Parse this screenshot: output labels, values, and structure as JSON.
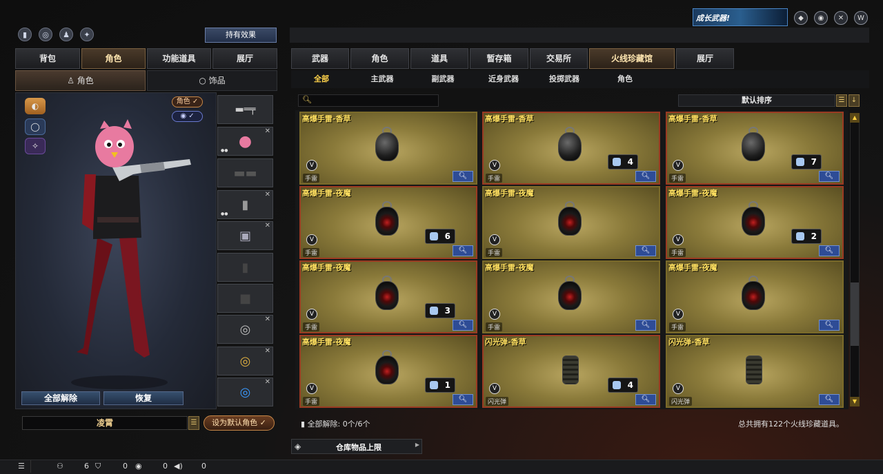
{
  "top": {
    "hold_effect": "持有效果",
    "promo": "成长武器!"
  },
  "left_tabs": [
    "背包",
    "角色",
    "功能道具",
    "展厅"
  ],
  "left_subtabs": [
    "角色",
    "饰品"
  ],
  "right_tabs": [
    "武器",
    "角色",
    "道具",
    "暂存箱",
    "交易所",
    "火线珍藏馆",
    "展厅"
  ],
  "categories": [
    "全部",
    "主武器",
    "副武器",
    "近身武器",
    "投掷武器",
    "角色"
  ],
  "character": {
    "toggle_role": "角色 ✓",
    "toggle_eye": "✓",
    "unequip_all": "全部解除",
    "restore": "恢复",
    "name": "凌霄",
    "set_default": "设为默认角色 ✓"
  },
  "sort_label": "默认排序",
  "items": [
    {
      "title": "高爆手雷-香草",
      "count": "",
      "tag": "手雷",
      "kind": "vanilla",
      "red": false
    },
    {
      "title": "高爆手雷-香草",
      "count": "4",
      "tag": "手雷",
      "kind": "vanilla",
      "red": true
    },
    {
      "title": "高爆手雷-香草",
      "count": "7",
      "tag": "手雷",
      "kind": "vanilla",
      "red": true
    },
    {
      "title": "高爆手雷-夜魔",
      "count": "6",
      "tag": "手雷",
      "kind": "night",
      "red": true
    },
    {
      "title": "高爆手雷-夜魔",
      "count": "",
      "tag": "手雷",
      "kind": "night",
      "red": false
    },
    {
      "title": "高爆手雷-夜魔",
      "count": "2",
      "tag": "手雷",
      "kind": "night",
      "red": true
    },
    {
      "title": "高爆手雷-夜魔",
      "count": "3",
      "tag": "手雷",
      "kind": "night",
      "red": true
    },
    {
      "title": "高爆手雷-夜魔",
      "count": "",
      "tag": "手雷",
      "kind": "night",
      "red": false
    },
    {
      "title": "高爆手雷-夜魔",
      "count": "",
      "tag": "手雷",
      "kind": "night",
      "red": false
    },
    {
      "title": "高爆手雷-夜魔",
      "count": "1",
      "tag": "手雷",
      "kind": "night",
      "red": true
    },
    {
      "title": "闪光弹-香草",
      "count": "4",
      "tag": "闪光弹",
      "kind": "flash",
      "red": true
    },
    {
      "title": "闪光弹-香草",
      "count": "",
      "tag": "闪光弹",
      "kind": "flash",
      "red": false
    }
  ],
  "footer": {
    "unequip_status": "全部解除: 0个/6个",
    "total": "总共拥有122个火线珍藏道具。",
    "storage": "仓库物品上限"
  },
  "statusbar": {
    "friends": "6",
    "clan": "0",
    "chat": "0",
    "voice": "0"
  }
}
